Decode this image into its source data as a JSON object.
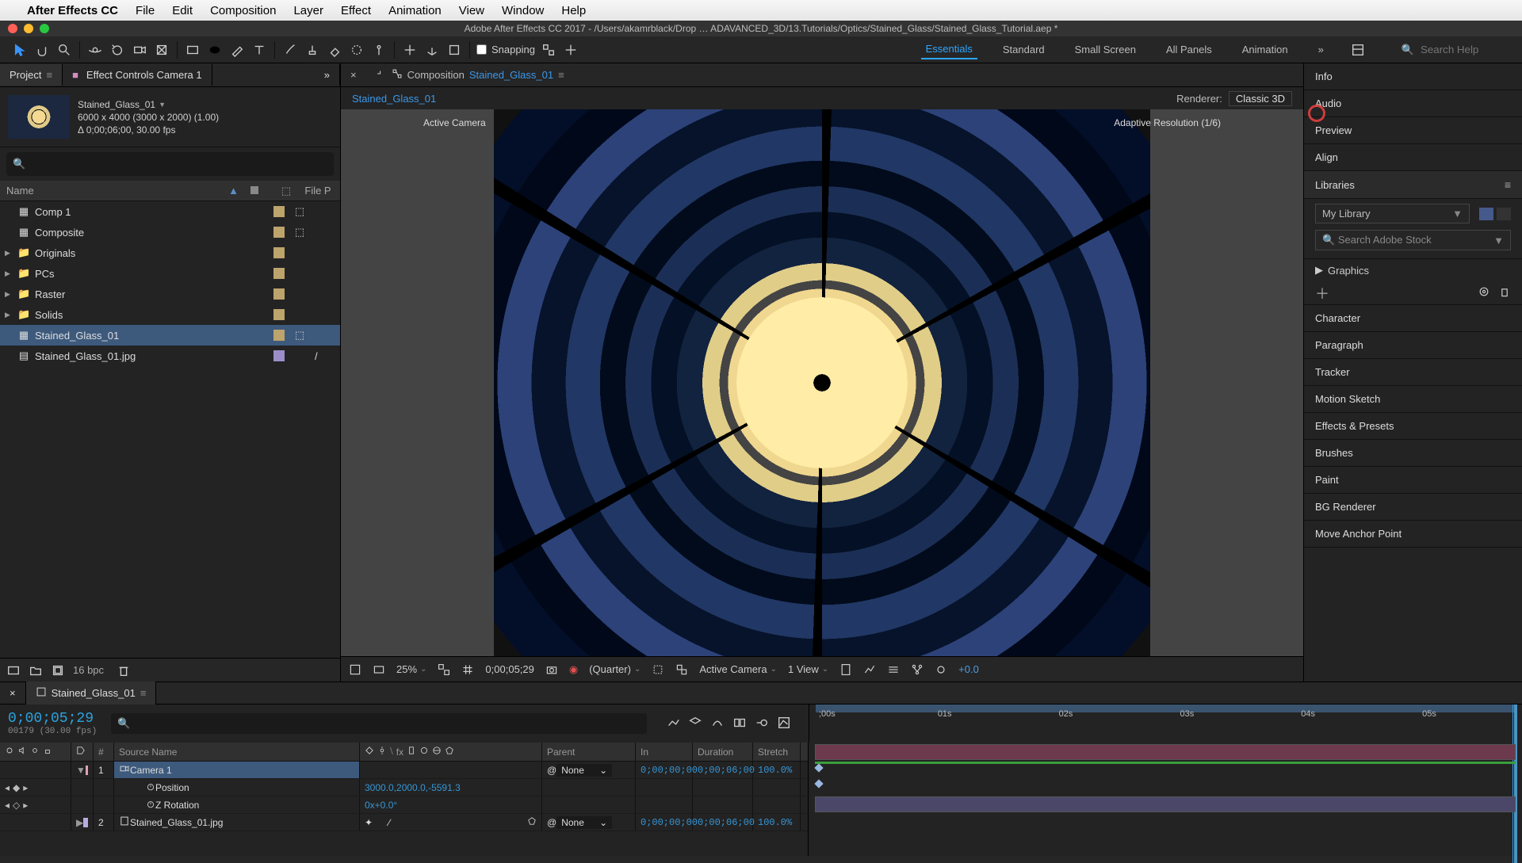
{
  "mac_menu": {
    "app": "After Effects CC",
    "items": [
      "File",
      "Edit",
      "Composition",
      "Layer",
      "Effect",
      "Animation",
      "View",
      "Window",
      "Help"
    ]
  },
  "window_title": "Adobe After Effects CC 2017 - /Users/akamrblack/Drop … ADAVANCED_3D/13.Tutorials/Optics/Stained_Glass/Stained_Glass_Tutorial.aep *",
  "toolbar": {
    "snapping": "Snapping"
  },
  "workspaces": [
    "Essentials",
    "Standard",
    "Small Screen",
    "All Panels",
    "Animation"
  ],
  "workspace_active": "Essentials",
  "search_placeholder": "Search Help",
  "project": {
    "tab": "Project",
    "effect_tab": "Effect Controls Camera 1",
    "comp_name": "Stained_Glass_01",
    "dims": "6000 x 4000  (3000 x 2000) (1.00)",
    "delta": "Δ 0;00;06;00, 30.00 fps",
    "cols": {
      "name": "Name",
      "filep": "File P"
    },
    "items": [
      {
        "icon": "comp",
        "name": "Comp 1",
        "sw": "tan"
      },
      {
        "icon": "comp",
        "name": "Composite",
        "sw": "tan"
      },
      {
        "icon": "folder",
        "name": "Originals",
        "sw": "tan",
        "twist": "▶"
      },
      {
        "icon": "folder",
        "name": "PCs",
        "sw": "tan",
        "twist": "▶"
      },
      {
        "icon": "folder",
        "name": "Raster",
        "sw": "tan",
        "twist": "▶"
      },
      {
        "icon": "folder",
        "name": "Solids",
        "sw": "tan",
        "twist": "▶"
      },
      {
        "icon": "comp",
        "name": "Stained_Glass_01",
        "sw": "tan",
        "sel": true
      },
      {
        "icon": "file",
        "name": "Stained_Glass_01.jpg",
        "sw": "vio",
        "extra": "/"
      }
    ],
    "footer": {
      "bpc": "16 bpc"
    }
  },
  "comp_panel": {
    "tab_prefix": "Composition",
    "tab_name": "Stained_Glass_01",
    "crumb": "Stained_Glass_01",
    "renderer_label": "Renderer:",
    "renderer_value": "Classic 3D",
    "active_camera": "Active Camera",
    "adaptive": "Adaptive Resolution (1/6)"
  },
  "viewer_controls": {
    "zoom": "25%",
    "time": "0;00;05;29",
    "res": "(Quarter)",
    "cam": "Active Camera",
    "view": "1 View",
    "exp": "+0.0"
  },
  "right_panels": [
    "Info",
    "Audio",
    "Preview",
    "Align"
  ],
  "libraries": {
    "title": "Libraries",
    "my": "My Library",
    "stock_placeholder": "Search Adobe Stock",
    "graphics": "Graphics"
  },
  "right_panels2": [
    "Character",
    "Paragraph",
    "Tracker",
    "Motion Sketch",
    "Effects & Presets",
    "Brushes",
    "Paint",
    "BG Renderer",
    "Move Anchor Point"
  ],
  "timeline": {
    "tab": "Stained_Glass_01",
    "timecode": "0;00;05;29",
    "tc_sub": "00179 (30.00 fps)",
    "headers": {
      "num": "#",
      "src": "Source Name",
      "parent": "Parent",
      "in": "In",
      "dur": "Duration",
      "str": "Stretch"
    },
    "ticks": [
      ";00s",
      "01s",
      "02s",
      "03s",
      "04s",
      "05s"
    ],
    "layers": [
      {
        "num": "1",
        "name": "Camera 1",
        "sw": "pink",
        "parent": "None",
        "in": "0;00;00;00",
        "dur": "0;00;06;00",
        "str": "100.0%",
        "sel": true,
        "type": "camera",
        "props": [
          {
            "name": "Position",
            "val": "3000.0,2000.0,-5591.3"
          },
          {
            "name": "Z Rotation",
            "val": "0x+0.0°"
          }
        ]
      },
      {
        "num": "2",
        "name": "Stained_Glass_01.jpg",
        "sw": "lav",
        "parent": "None",
        "in": "0;00;00;00",
        "dur": "0;00;06;00",
        "str": "100.0%",
        "type": "image"
      }
    ]
  }
}
